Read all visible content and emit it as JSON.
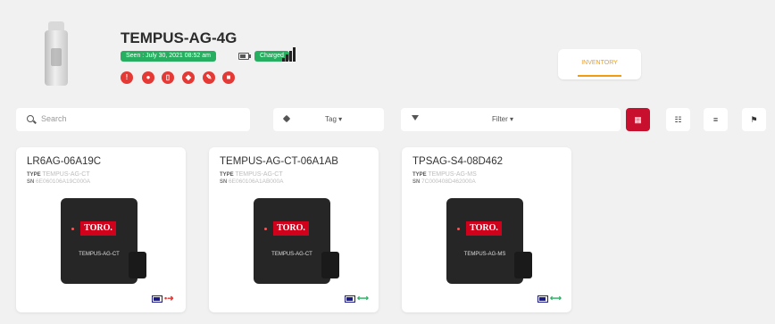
{
  "device": {
    "title": "TEMPUS-AG-4G",
    "seen": "Seen : July 30, 2021 08:52 am",
    "charged": "Charged",
    "inventory_label": "INVENTORY"
  },
  "toolbar": {
    "search_placeholder": "Search",
    "tag_label": "Tag ▾",
    "filter_label": "Filter ▾"
  },
  "cards": [
    {
      "name": "LR6AG-06A19C",
      "type_label": "TYPE",
      "type": "TEMPUS-AG-CT",
      "sn_label": "SN",
      "sn": "6E060106A19C000A",
      "model": "TEMPUS-AG-CT",
      "brand": "TORO.",
      "connected": false
    },
    {
      "name": "TEMPUS-AG-CT-06A1AB",
      "type_label": "TYPE",
      "type": "TEMPUS-AG-CT",
      "sn_label": "SN",
      "sn": "6E060106A1AB000A",
      "model": "TEMPUS-AG-CT",
      "brand": "TORO.",
      "connected": true
    },
    {
      "name": "TPSAG-S4-08D462",
      "type_label": "TYPE",
      "type": "TEMPUS-AG-MS",
      "sn_label": "SN",
      "sn": "7C000408D462000A",
      "model": "TEMPUS-AG-MS",
      "brand": "TORO.",
      "connected": true
    }
  ],
  "colors": {
    "accent": "#c8102e",
    "status_green": "#27ae60",
    "status_red": "#e53935",
    "inventory_orange": "#f39c12"
  }
}
